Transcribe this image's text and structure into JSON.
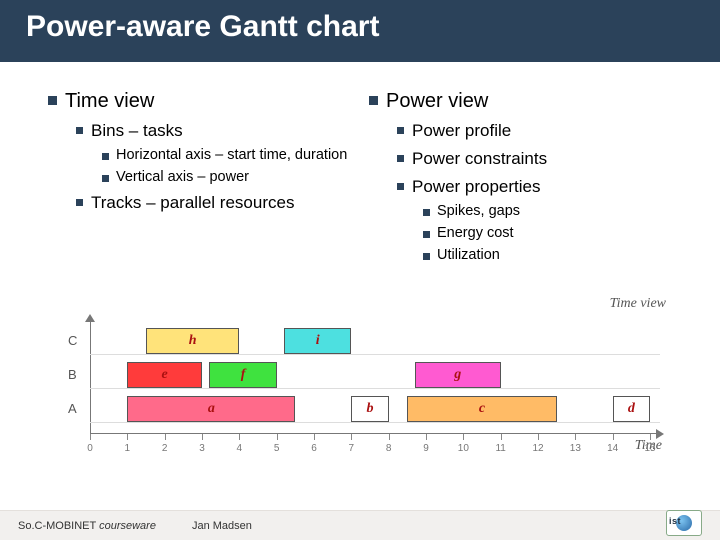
{
  "title": "Power-aware Gantt chart",
  "left": {
    "heading": "Time view",
    "sub1": {
      "label": "Bins – tasks",
      "items": [
        "Horizontal axis – start time, duration",
        "Vertical axis – power"
      ]
    },
    "sub2": {
      "label": "Tracks – parallel resources"
    }
  },
  "right": {
    "heading": "Power view",
    "items": [
      "Power profile",
      "Power constraints",
      "Power properties"
    ],
    "subitems": [
      "Spikes, gaps",
      "Energy cost",
      "Utilization"
    ]
  },
  "chart_data": {
    "type": "bar",
    "title": "Time view",
    "xlabel": "Time",
    "ylabel": "",
    "xlim": [
      0,
      15
    ],
    "categories": [
      "A",
      "B",
      "C"
    ],
    "xticks": [
      0,
      1,
      2,
      3,
      4,
      5,
      6,
      7,
      8,
      9,
      10,
      11,
      12,
      13,
      14,
      15
    ],
    "tasks": [
      {
        "name": "a",
        "track": "A",
        "start": 1,
        "end": 5.5,
        "color": "#ff6a8a"
      },
      {
        "name": "b",
        "track": "A",
        "start": 7,
        "end": 8,
        "color": "#ffffff"
      },
      {
        "name": "c",
        "track": "A",
        "start": 8.5,
        "end": 12.5,
        "color": "#ffbb66"
      },
      {
        "name": "d",
        "track": "A",
        "start": 14,
        "end": 15,
        "color": "#ffffff"
      },
      {
        "name": "e",
        "track": "B",
        "start": 1,
        "end": 3,
        "color": "#ff3b3b"
      },
      {
        "name": "f",
        "track": "B",
        "start": 3.2,
        "end": 5,
        "color": "#3fe23f"
      },
      {
        "name": "g",
        "track": "B",
        "start": 8.7,
        "end": 11,
        "color": "#ff5ad1"
      },
      {
        "name": "h",
        "track": "C",
        "start": 1.5,
        "end": 4,
        "color": "#ffe37a"
      },
      {
        "name": "i",
        "track": "C",
        "start": 5.2,
        "end": 7,
        "color": "#4de0e0"
      }
    ]
  },
  "footer": {
    "courseware_prefix": "So.C-MOBINET",
    "courseware_suffix": "courseware",
    "author": "Jan Madsen",
    "logo_text": "ist"
  }
}
